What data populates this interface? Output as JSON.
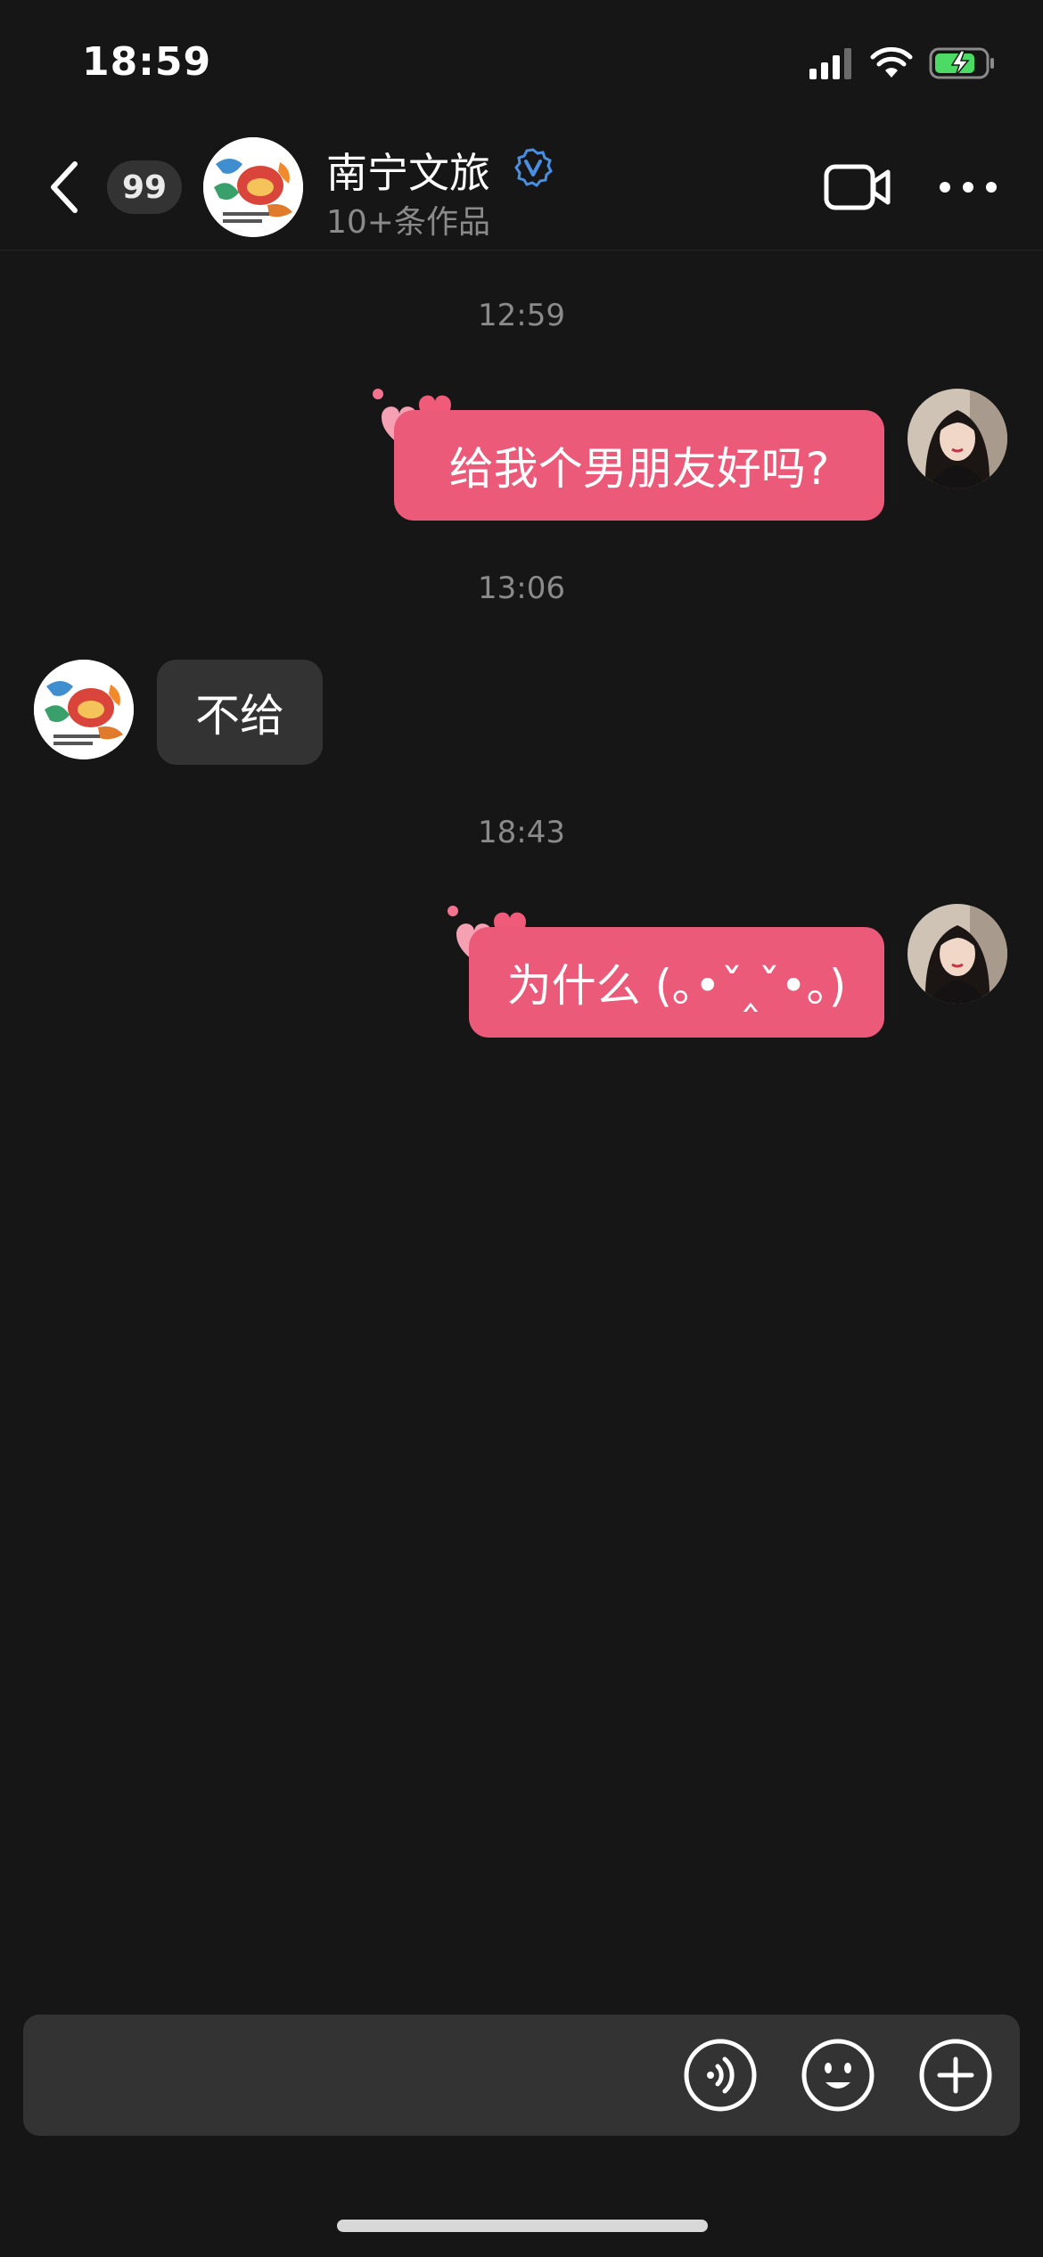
{
  "status_bar": {
    "time": "18:59"
  },
  "header": {
    "unread_count": "99",
    "name": "南宁文旅",
    "subtitle": "10+条作品"
  },
  "messages": [
    {
      "timestamp": "12:59",
      "sender": "me",
      "text": "给我个男朋友好吗?"
    },
    {
      "timestamp": "13:06",
      "sender": "other",
      "text": "不给"
    },
    {
      "timestamp": "18:43",
      "sender": "me",
      "text": "为什么 (｡•ˇ‸ˇ•｡)"
    }
  ],
  "input_bar": {
    "value": ""
  },
  "colors": {
    "background": "#161616",
    "bubble_me": "#ec5a79",
    "bubble_other": "#333333",
    "verified": "#4a90e2",
    "battery": "#4cd964"
  }
}
